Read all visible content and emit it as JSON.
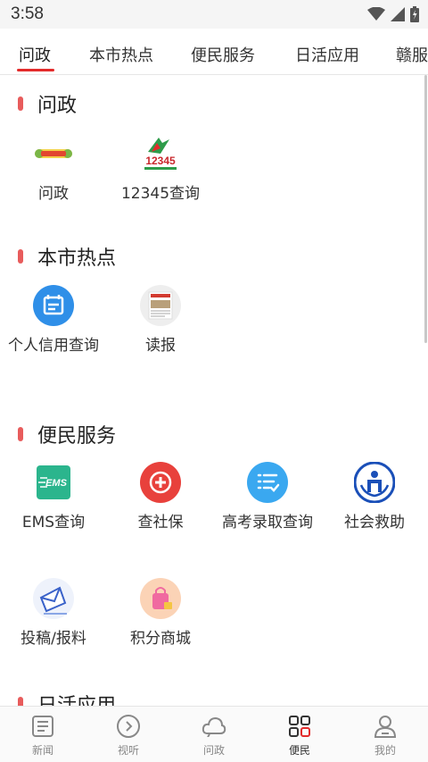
{
  "status_bar": {
    "time": "3:58"
  },
  "tabs": [
    {
      "label": "问政"
    },
    {
      "label": "本市热点"
    },
    {
      "label": "便民服务"
    },
    {
      "label": "日活应用"
    },
    {
      "label": "赣服"
    }
  ],
  "sections": [
    {
      "title": "问政",
      "items": [
        {
          "label": "问政"
        },
        {
          "label": "12345查询"
        }
      ]
    },
    {
      "title": "本市热点",
      "items": [
        {
          "label": "个人信用查询"
        },
        {
          "label": "读报"
        }
      ]
    },
    {
      "title": "便民服务",
      "items": [
        {
          "label": "EMS查询"
        },
        {
          "label": "查社保"
        },
        {
          "label": "高考录取查询"
        },
        {
          "label": "社会救助"
        },
        {
          "label": "投稿/报料"
        },
        {
          "label": "积分商城"
        }
      ]
    },
    {
      "title": "日活应用"
    }
  ],
  "icon_text": {
    "ems": "EMS",
    "hotline_number": "12345"
  },
  "bottom_nav": [
    {
      "label": "新闻"
    },
    {
      "label": "视听"
    },
    {
      "label": "问政"
    },
    {
      "label": "便民"
    },
    {
      "label": "我的"
    }
  ],
  "colors": {
    "accent": "#e32b2b",
    "section_mark": "#e85c5c",
    "ems_green": "#2bb58d",
    "social_red": "#e8413c",
    "exam_blue": "#3aa8f0",
    "credit_blue": "#2f8fe8",
    "rescue_blue": "#1a4fb8"
  },
  "icons": [
    "signal-icon",
    "wifi-icon",
    "battery-icon",
    "news-icon",
    "play-icon",
    "cloud-icon",
    "grid-icon",
    "person-icon"
  ]
}
